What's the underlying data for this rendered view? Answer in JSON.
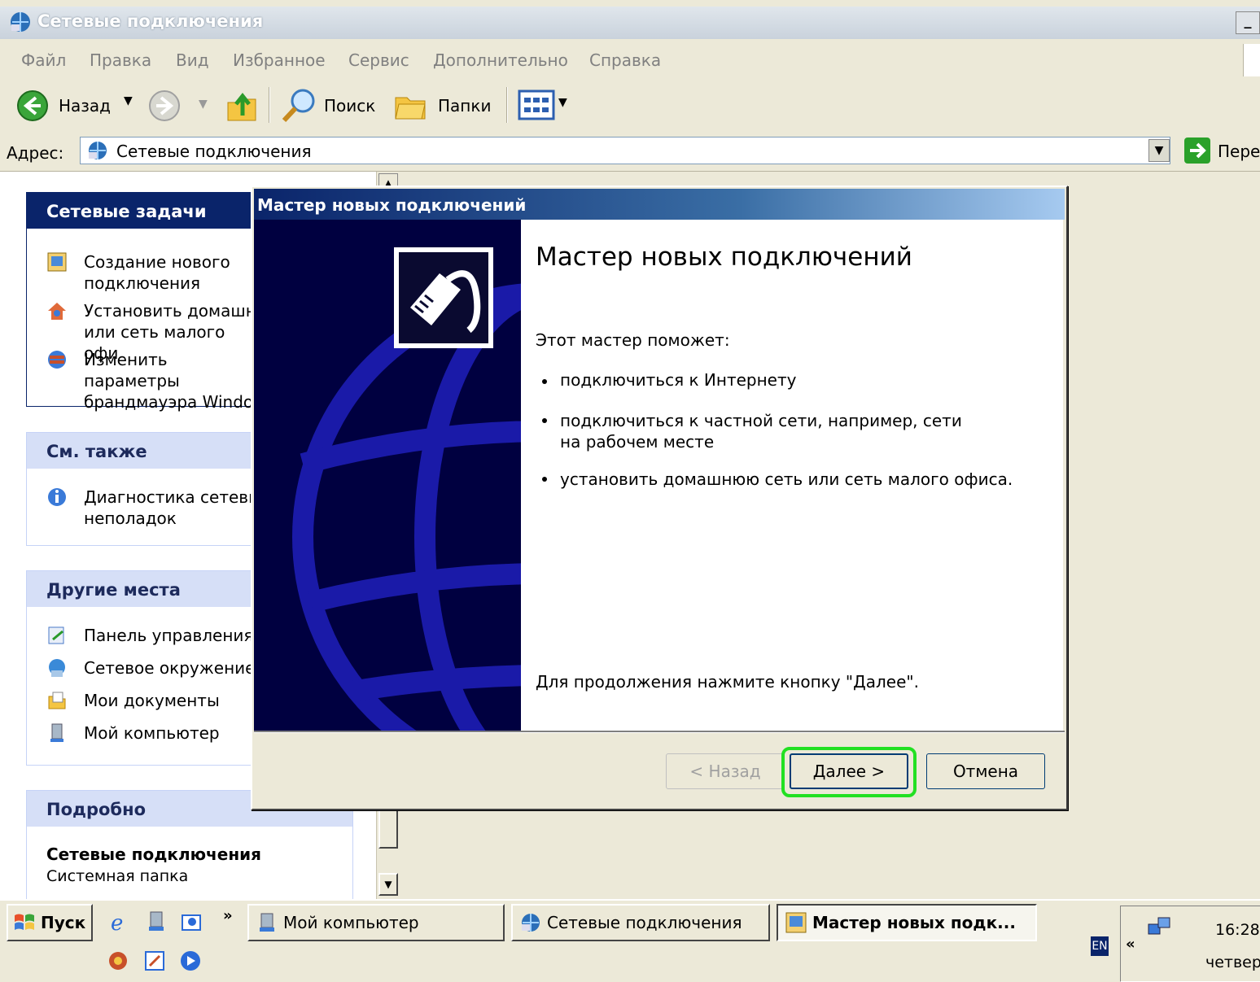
{
  "explorer": {
    "title": "Сетевые подключения",
    "menu": [
      "Файл",
      "Правка",
      "Вид",
      "Избранное",
      "Сервис",
      "Дополнительно",
      "Справка"
    ],
    "toolbar": {
      "back": "Назад",
      "search": "Поиск",
      "folders": "Папки"
    },
    "address": {
      "label": "Адрес:",
      "value": "Сетевые подключения",
      "go": "Пере"
    }
  },
  "taskpane": {
    "network_tasks": {
      "title": "Сетевые задачи",
      "items": [
        "Создание нового подключения",
        "Установить домашн или сеть малого офи",
        "Изменить параметры брандмауэра Windo"
      ]
    },
    "see_also": {
      "title": "См. также",
      "items": [
        "Диагностика сетевы неполадок"
      ]
    },
    "other_places": {
      "title": "Другие места",
      "items": [
        "Панель управления",
        "Сетевое окружение",
        "Мои документы",
        "Мой компьютер"
      ]
    },
    "details": {
      "title": "Подробно",
      "name": "Сетевые подключения",
      "type": "Системная папка"
    }
  },
  "wizard": {
    "title": "Мастер новых подключений",
    "heading": "Мастер новых подключений",
    "intro": "Этот мастер поможет:",
    "bullets": [
      "подключиться к Интернету",
      "подключиться к частной сети, например, сети на рабочем месте",
      "установить домашнюю сеть или сеть малого офиса."
    ],
    "continue": "Для продолжения нажмите кнопку \"Далее\".",
    "buttons": {
      "back": "< Назад",
      "next": "Далее >",
      "cancel": "Отмена"
    },
    "highlight_color": "#22e022"
  },
  "taskbar": {
    "start": "Пуск",
    "tasks": [
      "Мой компьютер",
      "Сетевые подключения",
      "Мастер новых подк..."
    ],
    "lang": "EN",
    "time": "16:28",
    "day": "четвер"
  }
}
